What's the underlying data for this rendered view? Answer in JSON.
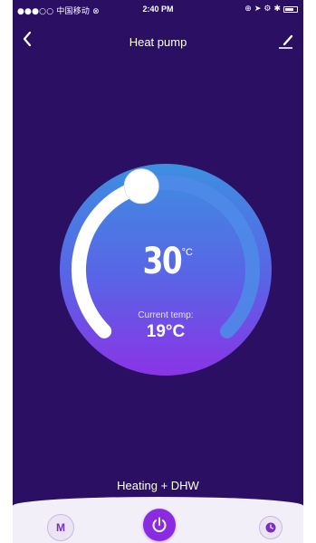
{
  "status_bar": {
    "carrier": "●●●○○ 中国移动 ⊗",
    "time": "2:40 PM"
  },
  "nav": {
    "title": "Heat pump",
    "back_icon": "chevron-left-icon",
    "edit_icon": "edit-pen-icon"
  },
  "thermostat": {
    "setpoint": "30",
    "setpoint_unit": "°C",
    "setpoint_value": 30,
    "current_label": "Current temp:",
    "current_temp": "19°C",
    "level_fraction": 0.44
  },
  "mode": {
    "label": "Heating + DHW"
  },
  "controls": {
    "mode_button_label": "M",
    "power_icon": "power-icon",
    "timer_icon": "clock-icon"
  },
  "colors": {
    "background": "#2a0f63",
    "accent": "#8a2be2",
    "dial_top": "#3d8fe0",
    "dial_bottom": "#7a3be6",
    "bottom_bar": "#f3eff8"
  }
}
